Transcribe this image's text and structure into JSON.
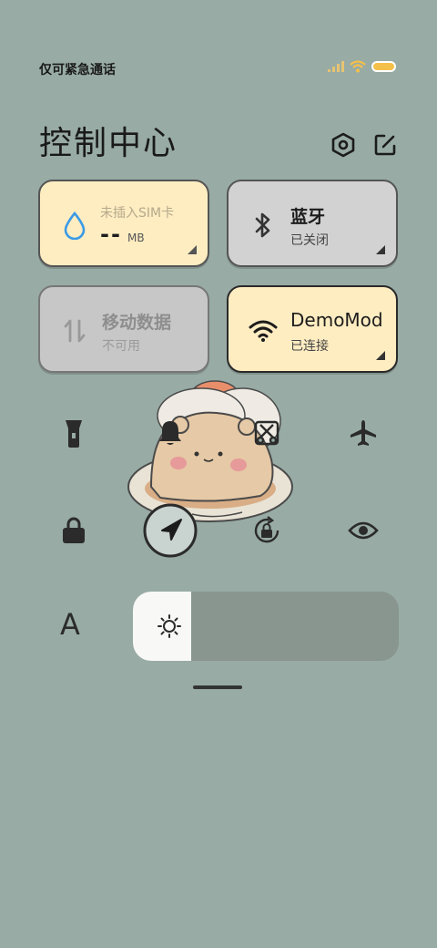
{
  "status_bar": {
    "carrier_text": "仅可紧急通话",
    "icons": [
      "signal-icon",
      "wifi-icon",
      "battery-icon"
    ],
    "battery_color": "#F5C04A"
  },
  "header": {
    "title": "控制中心",
    "settings_icon": "settings-hexagon-icon",
    "edit_icon": "edit-icon"
  },
  "tiles": {
    "data_usage": {
      "label": "未插入SIM卡",
      "value": "--",
      "unit": "MB",
      "icon": "water-drop-icon",
      "color": "#FFEDC2"
    },
    "bluetooth": {
      "title": "蓝牙",
      "status": "已关闭",
      "icon": "bluetooth-icon"
    },
    "mobile_data": {
      "title": "移动数据",
      "status": "不可用",
      "icon": "data-transfer-icon"
    },
    "wifi": {
      "title": "DemoMod",
      "status": "已连接",
      "icon": "wifi-icon"
    }
  },
  "quick_toggles": [
    {
      "name": "flashlight",
      "icon": "flashlight-icon",
      "active": false
    },
    {
      "name": "silent",
      "icon": "bell-icon",
      "active": false
    },
    {
      "name": "screenshot",
      "icon": "scissors-icon",
      "active": false
    },
    {
      "name": "airplane",
      "icon": "airplane-icon",
      "active": false
    },
    {
      "name": "lock",
      "icon": "lock-icon",
      "active": false
    },
    {
      "name": "location",
      "icon": "location-arrow-icon",
      "active": true
    },
    {
      "name": "rotation-lock",
      "icon": "rotation-lock-icon",
      "active": false
    },
    {
      "name": "eye-comfort",
      "icon": "eye-icon",
      "active": false
    }
  ],
  "bottom_row": {
    "text_size_label": "A",
    "brightness_icon": "sun-icon",
    "brightness_level": 0.22
  },
  "colors": {
    "background": "#98ABA5",
    "tile_active": "#FFEDC2",
    "tile_inactive": "#D2D2D2",
    "slider_track": "#88968F"
  }
}
